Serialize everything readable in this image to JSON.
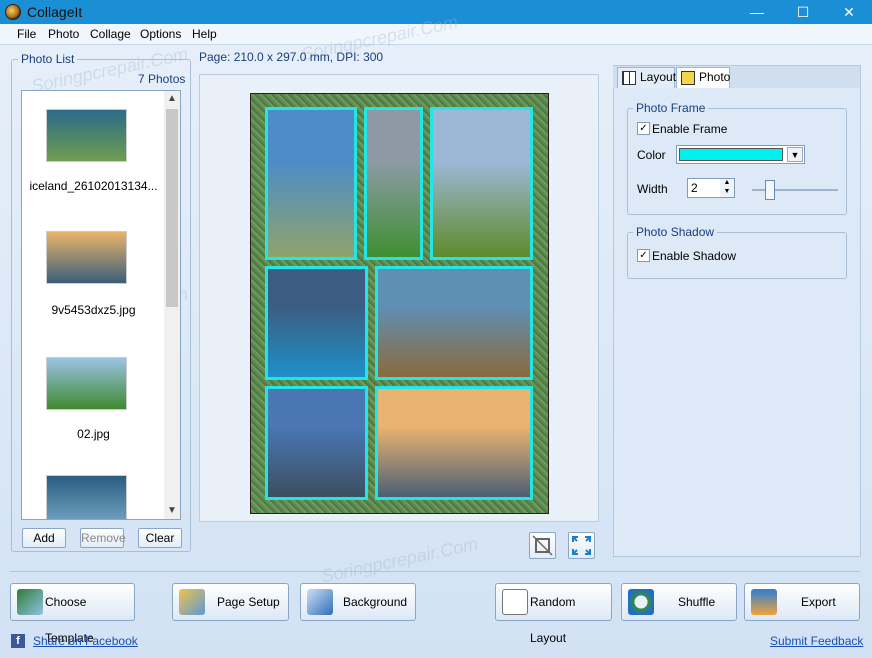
{
  "window": {
    "title": "CollageIt",
    "min": "—",
    "max": "☐",
    "close": "✕"
  },
  "menu": [
    "File",
    "Photo",
    "Collage",
    "Options",
    "Help"
  ],
  "page_info": "Page: 210.0 x 297.0 mm, DPI: 300",
  "photo_list": {
    "legend": "Photo List",
    "count": "7 Photos",
    "items": [
      {
        "name": "iceland_26102013134...",
        "colors": [
          "#2b6b8a",
          "#6f9d4e"
        ]
      },
      {
        "name": "9v5453dxz5.jpg",
        "colors": [
          "#e9b36a",
          "#3b5f7c"
        ]
      },
      {
        "name": "02.jpg",
        "colors": [
          "#9cc3e6",
          "#3f8a2e"
        ]
      },
      {
        "name": "",
        "colors": [
          "#2a5d80",
          "#7aa9c9"
        ]
      }
    ],
    "buttons": {
      "add": "Add",
      "remove": "Remove",
      "clear": "Clear"
    }
  },
  "collage_cells": [
    {
      "colors": [
        "#4d8cc7",
        "#8fa36b"
      ]
    },
    {
      "colors": [
        "#8d9aa6",
        "#3f8f32"
      ]
    },
    {
      "colors": [
        "#9db8d6",
        "#5f8a2b"
      ]
    },
    {
      "colors": [
        "#3c5d83",
        "#1e90c8"
      ]
    },
    {
      "colors": [
        "#5f8fb3",
        "#8b6a3c"
      ]
    },
    {
      "colors": [
        "#4a76b4",
        "#3c4f5f"
      ]
    },
    {
      "colors": [
        "#eab36f",
        "#4b5f74"
      ]
    }
  ],
  "right_panel": {
    "tabs": {
      "layout": "Layout",
      "photo": "Photo"
    },
    "photo_frame": {
      "legend": "Photo Frame",
      "enable_frame": "Enable Frame",
      "color_label": "Color",
      "color_value": "#00f0f0",
      "width_label": "Width",
      "width_value": "2"
    },
    "photo_shadow": {
      "legend": "Photo Shadow",
      "enable_shadow": "Enable Shadow"
    }
  },
  "toolbar": {
    "choose_template": "Choose Template",
    "page_setup": "Page Setup",
    "background": "Background",
    "random_layout": "Random Layout",
    "shuffle": "Shuffle",
    "export": "Export"
  },
  "footer": {
    "share": "Share on Facebook",
    "feedback": "Submit Feedback"
  },
  "watermark": "Soringpcrepair.Com"
}
